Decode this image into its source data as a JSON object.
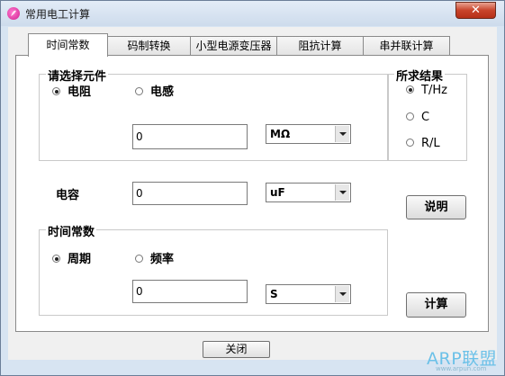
{
  "window": {
    "title": "常用电工计算",
    "close_glyph": "✕"
  },
  "tabs": [
    {
      "label": "时间常数",
      "active": true
    },
    {
      "label": "码制转换",
      "active": false
    },
    {
      "label": "小型电源变压器",
      "active": false
    },
    {
      "label": "阻抗计算",
      "active": false
    },
    {
      "label": "串并联计算",
      "active": false
    }
  ],
  "component_group": {
    "title": "请选择元件",
    "options": [
      {
        "label": "电阻",
        "checked": true
      },
      {
        "label": "电感",
        "checked": false
      }
    ],
    "value": "0",
    "unit": "MΩ"
  },
  "result_group": {
    "title": "所求结果",
    "options": [
      {
        "label": "T/Hz",
        "checked": true
      },
      {
        "label": "C",
        "checked": false
      },
      {
        "label": "R/L",
        "checked": false
      }
    ]
  },
  "capacitor": {
    "label": "电容",
    "value": "0",
    "unit": "uF"
  },
  "time_group": {
    "title": "时间常数",
    "options": [
      {
        "label": "周期",
        "checked": true
      },
      {
        "label": "频率",
        "checked": false
      }
    ],
    "value": "0",
    "unit": "S"
  },
  "buttons": {
    "help": "说明",
    "calculate": "计算",
    "close": "关闭"
  },
  "watermark": {
    "brand": "ARP联盟",
    "url": "www.arpun.com"
  }
}
